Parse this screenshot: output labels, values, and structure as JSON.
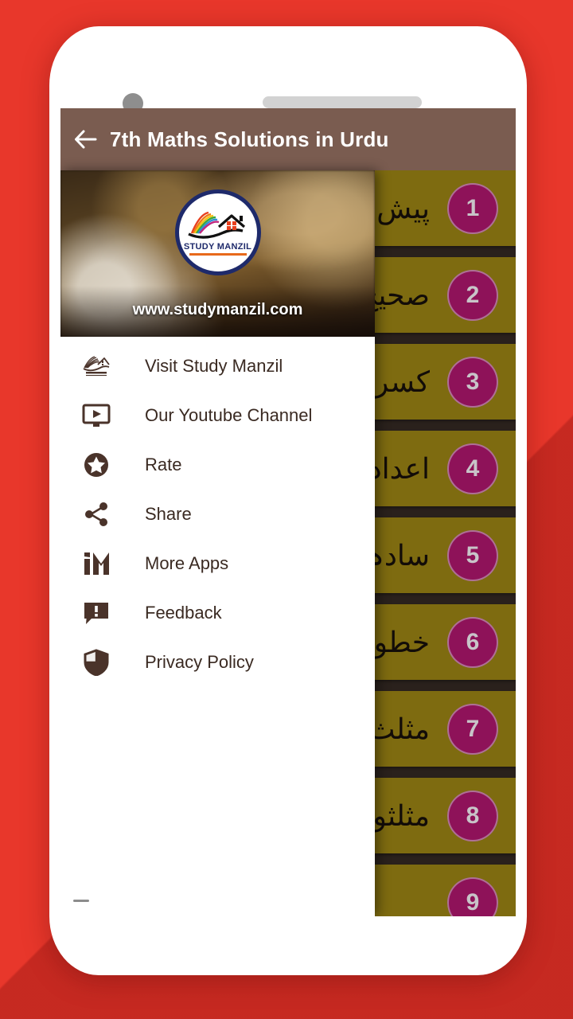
{
  "background": {
    "color": "#E8372B",
    "shadow_color": "#7A0A0A"
  },
  "device": {
    "frame_color": "#FFFFFF",
    "camera_icon": "camera-dot",
    "speaker_icon": "earpiece-speaker"
  },
  "appbar": {
    "title": "7th Maths Solutions in Urdu",
    "back_icon": "back-arrow-icon",
    "bg_color": "#7A5C50",
    "text_color": "#FFFFFF"
  },
  "drawer": {
    "header": {
      "logo_name": "study-manzil-logo",
      "logo_text_primary": "STUDY",
      "logo_text_secondary": "MANZIL",
      "site_url": "www.studymanzil.com"
    },
    "items": [
      {
        "label": "Visit Study Manzil",
        "icon": "study-manzil-mark-icon"
      },
      {
        "label": "Our Youtube Channel",
        "icon": "video-monitor-icon"
      },
      {
        "label": "Rate",
        "icon": "star-circle-icon"
      },
      {
        "label": "Share",
        "icon": "share-nodes-icon"
      },
      {
        "label": "More Apps",
        "icon": "im-monogram-icon"
      },
      {
        "label": "Feedback",
        "icon": "speech-bubble-alert-icon"
      },
      {
        "label": "Privacy Policy",
        "icon": "shield-icon"
      }
    ]
  },
  "content": {
    "bg_color": "#2A211C",
    "item_color": "#7E6B10",
    "badge_color": "#8E1259",
    "items": [
      {
        "number": "1",
        "label": "پیش"
      },
      {
        "number": "2",
        "label": "صحیح"
      },
      {
        "number": "3",
        "label": "کسری"
      },
      {
        "number": "4",
        "label": "اعداد"
      },
      {
        "number": "5",
        "label": "سادہ"
      },
      {
        "number": "6",
        "label": "خطوط"
      },
      {
        "number": "7",
        "label": "مثلث"
      },
      {
        "number": "8",
        "label": "مثلثوں"
      },
      {
        "number": "9",
        "label": ""
      }
    ]
  }
}
